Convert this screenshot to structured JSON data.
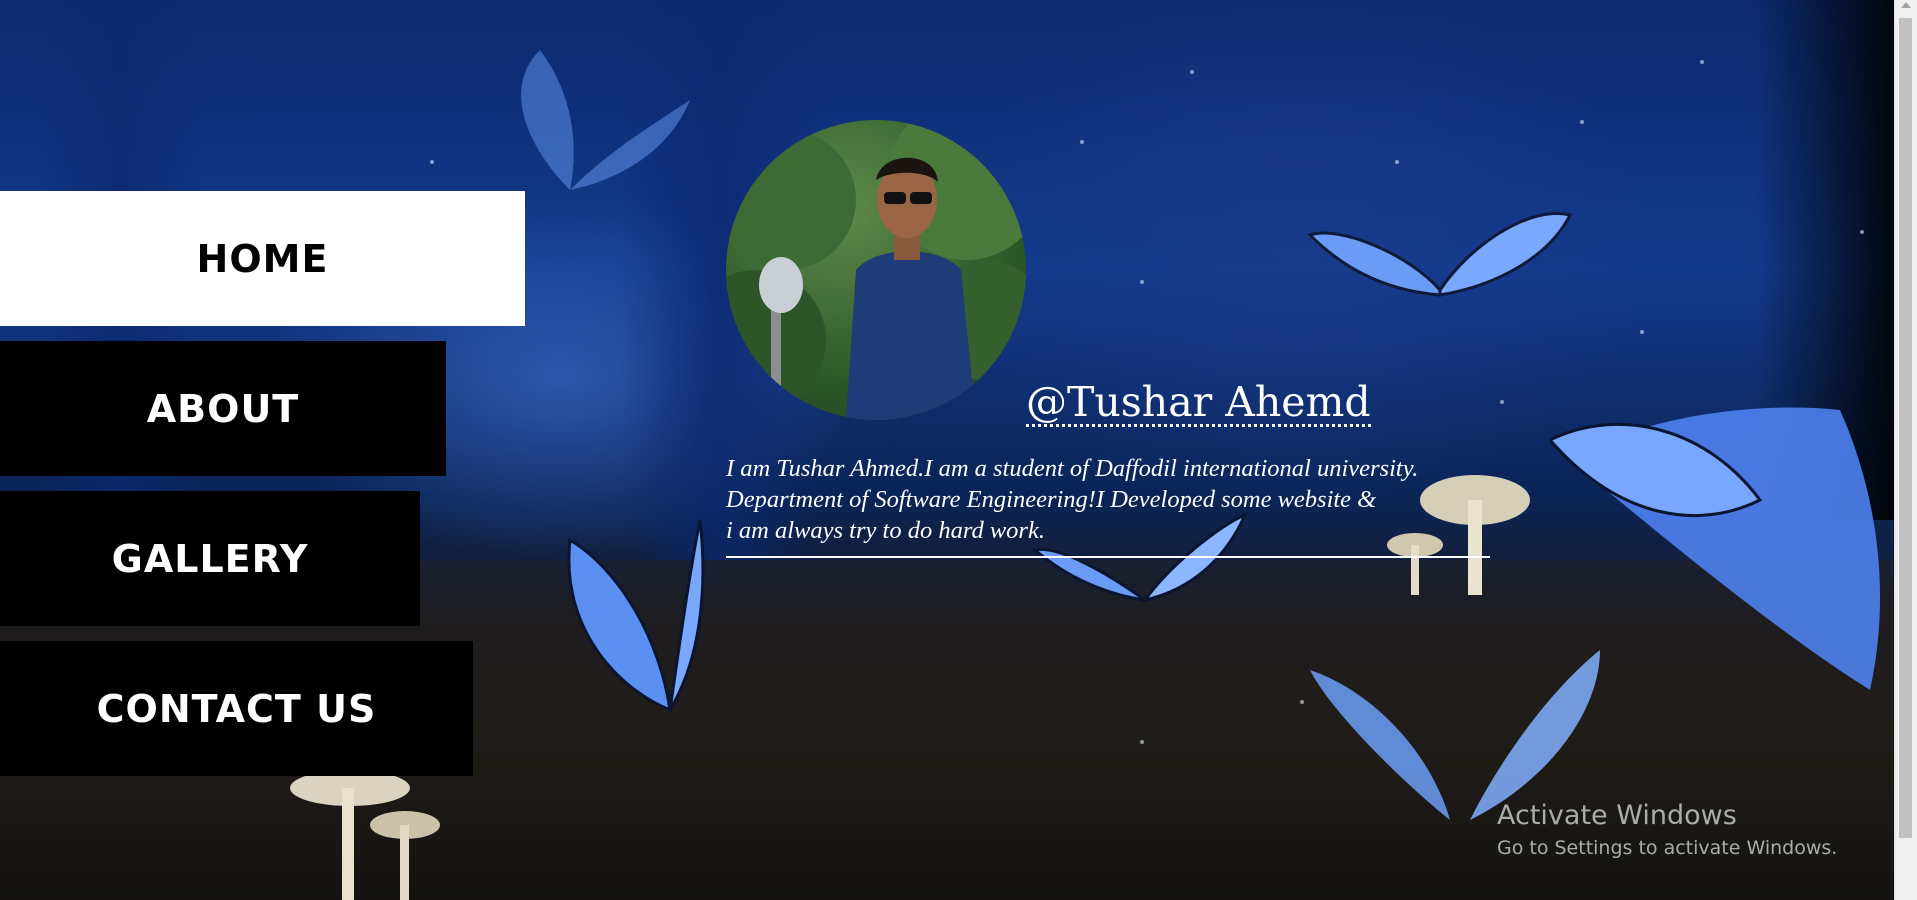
{
  "nav": {
    "home_label": "HOME",
    "about_label": "ABOUT",
    "gallery_label": "GALLERY",
    "contact_label": "CONTACT US"
  },
  "profile": {
    "handle": "@Tushar Ahemd",
    "bio_lines": [
      "I am Tushar Ahmed.I am a student of Daffodil international university.",
      "Department of Software Engineering!I Developed some website &",
      "i am always try to do hard work."
    ]
  },
  "watermark": {
    "title": "Activate Windows",
    "subtitle": "Go to Settings to activate Windows."
  },
  "colors": {
    "nav_active_bg": "#ffffff",
    "nav_bg": "#000000",
    "text": "#ffffff",
    "butterfly": "#5a8df0"
  }
}
